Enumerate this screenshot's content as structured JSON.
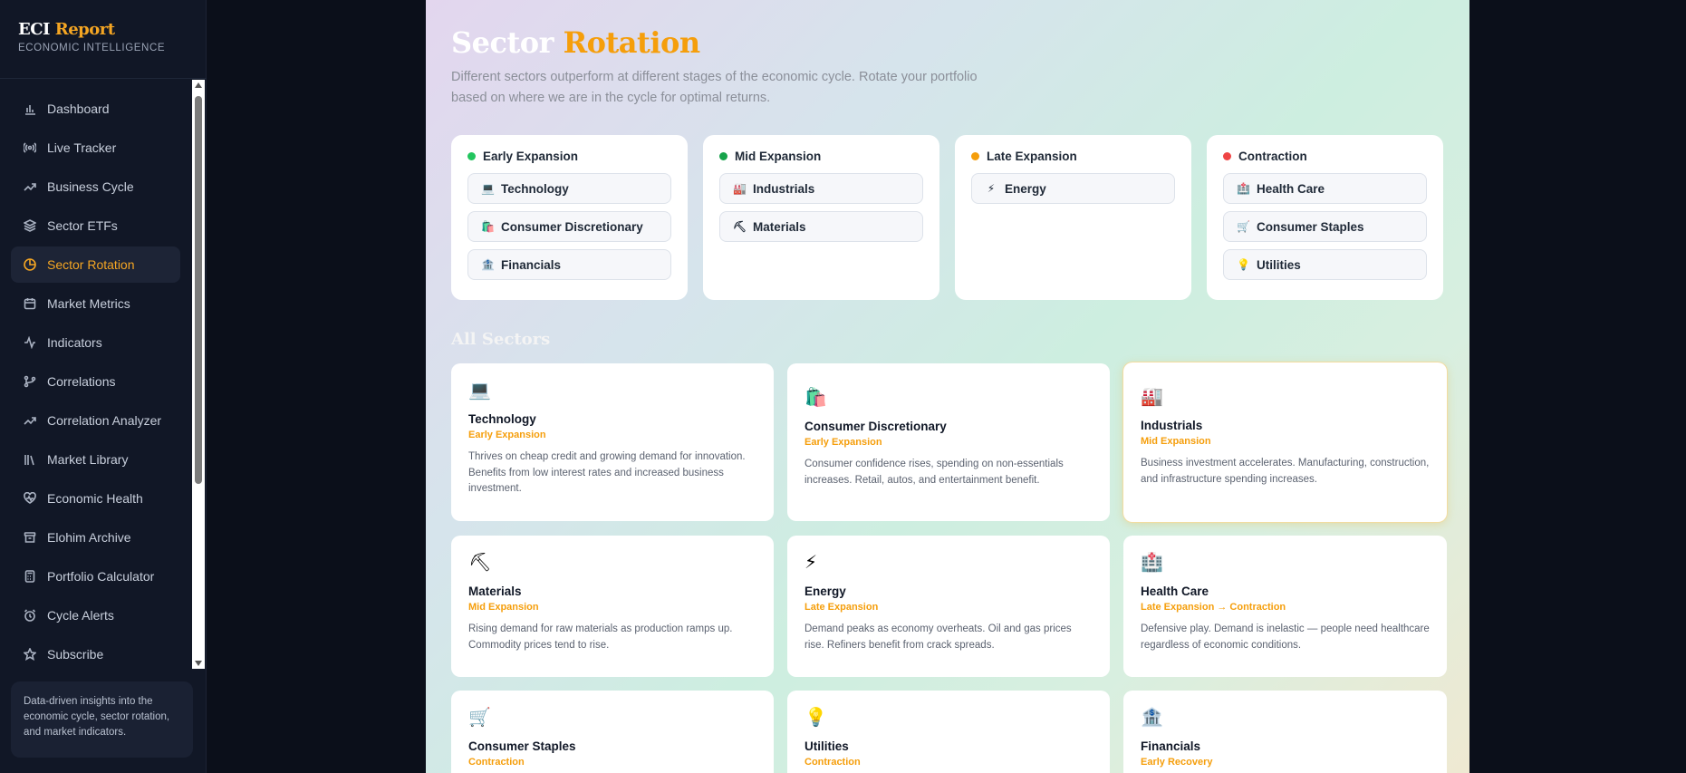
{
  "brand": {
    "title_main": "ECI",
    "title_accent": "Report",
    "subtitle": "ECONOMIC INTELLIGENCE"
  },
  "nav": {
    "items": [
      {
        "label": "Dashboard",
        "icon": "bar-chart-icon"
      },
      {
        "label": "Live Tracker",
        "icon": "broadcast-icon"
      },
      {
        "label": "Business Cycle",
        "icon": "trending-up-icon"
      },
      {
        "label": "Sector ETFs",
        "icon": "layers-icon"
      },
      {
        "label": "Sector Rotation",
        "icon": "pie-chart-icon",
        "active": true
      },
      {
        "label": "Market Metrics",
        "icon": "calendar-icon"
      },
      {
        "label": "Indicators",
        "icon": "activity-icon"
      },
      {
        "label": "Correlations",
        "icon": "git-branch-icon"
      },
      {
        "label": "Correlation Analyzer",
        "icon": "trending-up-icon"
      },
      {
        "label": "Market Library",
        "icon": "library-icon"
      },
      {
        "label": "Economic Health",
        "icon": "heart-pulse-icon"
      },
      {
        "label": "Elohim Archive",
        "icon": "archive-icon"
      },
      {
        "label": "Portfolio Calculator",
        "icon": "calculator-icon"
      },
      {
        "label": "Cycle Alerts",
        "icon": "alarm-icon"
      },
      {
        "label": "Subscribe",
        "icon": "star-icon"
      }
    ]
  },
  "sidebar_footer": "Data-driven insights into the economic cycle, sector rotation, and market indicators.",
  "hero": {
    "title_main": "Sector",
    "title_accent": "Rotation",
    "description": "Different sectors outperform at different stages of the economic cycle. Rotate your portfolio based on where we are in the cycle for optimal returns."
  },
  "phases": [
    {
      "name": "Early Expansion",
      "color": "#22c55e",
      "sectors": [
        "Technology",
        "Consumer Discretionary",
        "Financials"
      ]
    },
    {
      "name": "Mid Expansion",
      "color": "#16a34a",
      "sectors": [
        "Industrials",
        "Materials"
      ]
    },
    {
      "name": "Late Expansion",
      "color": "#f59e0b",
      "sectors": [
        "Energy"
      ]
    },
    {
      "name": "Contraction",
      "color": "#ef4444",
      "sectors": [
        "Health Care",
        "Consumer Staples",
        "Utilities"
      ]
    }
  ],
  "all_sectors_title": "All Sectors",
  "sectors": [
    {
      "name": "Technology",
      "icon": "laptop-icon",
      "phase": "Early Expansion",
      "desc": "Thrives on cheap credit and growing demand for innovation. Benefits from low interest rates and increased business investment."
    },
    {
      "name": "Consumer Discretionary",
      "icon": "shopping-bags-icon",
      "phase": "Early Expansion",
      "desc": "Consumer confidence rises, spending on non-essentials increases. Retail, autos, and entertainment benefit."
    },
    {
      "name": "Industrials",
      "icon": "factory-icon",
      "phase": "Mid Expansion",
      "desc": "Business investment accelerates. Manufacturing, construction, and infrastructure spending increases."
    },
    {
      "name": "Materials",
      "icon": "pick-icon",
      "phase": "Mid Expansion",
      "desc": "Rising demand for raw materials as production ramps up. Commodity prices tend to rise."
    },
    {
      "name": "Energy",
      "icon": "lightning-icon",
      "phase": "Late Expansion",
      "desc": "Demand peaks as economy overheats. Oil and gas prices rise. Refiners benefit from crack spreads."
    },
    {
      "name": "Health Care",
      "icon": "medical-kit-icon",
      "phase": "Late Expansion → Contraction",
      "desc": "Defensive play. Demand is inelastic — people need healthcare regardless of economic conditions."
    },
    {
      "name": "Consumer Staples",
      "icon": "cart-icon",
      "phase": "Contraction",
      "desc": ""
    },
    {
      "name": "Utilities",
      "icon": "lightbulb-icon",
      "phase": "Contraction",
      "desc": ""
    },
    {
      "name": "Financials",
      "icon": "bank-icon",
      "phase": "Early Recovery",
      "desc": ""
    }
  ]
}
